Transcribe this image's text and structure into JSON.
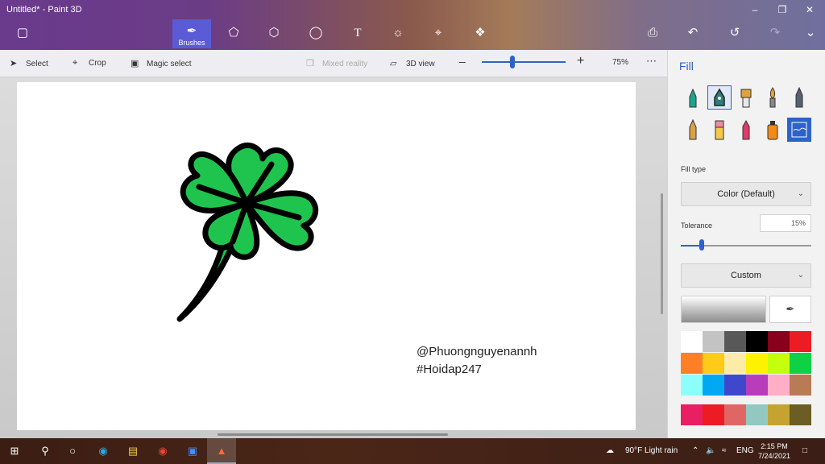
{
  "window": {
    "title": "Untitled* - Paint 3D"
  },
  "toolbar": {
    "tools": [
      {
        "name": "brushes",
        "label": "Brushes",
        "icon": "brush-icon",
        "active": true
      },
      {
        "name": "2d-shapes",
        "label": "",
        "icon": "2d-shapes-icon"
      },
      {
        "name": "3d-shapes",
        "label": "",
        "icon": "3d-shapes-icon"
      },
      {
        "name": "stickers",
        "label": "",
        "icon": "stickers-icon"
      },
      {
        "name": "text",
        "label": "",
        "icon": "text-icon"
      },
      {
        "name": "effects",
        "label": "",
        "icon": "effects-icon"
      },
      {
        "name": "canvas",
        "label": "",
        "icon": "canvas-icon"
      },
      {
        "name": "3d-library",
        "label": "",
        "icon": "3d-library-icon"
      }
    ]
  },
  "subbar": {
    "select": "Select",
    "crop": "Crop",
    "magic_select": "Magic select",
    "mixed_reality": "Mixed reality",
    "view_3d": "3D view",
    "zoom": "75%",
    "zoom_level": 0.38
  },
  "canvas": {
    "watermark_line1": "@Phuongnguyenannh",
    "watermark_line2": "#Hoidap247"
  },
  "panel": {
    "title": "Fill",
    "fill_type_label": "Fill type",
    "fill_type_value": "Color (Default)",
    "tolerance_label": "Tolerance",
    "tolerance_value": "15%",
    "tolerance_level": 0.15,
    "color_mode": "Custom",
    "brushes": [
      {
        "name": "marker",
        "color": "#1aa68c"
      },
      {
        "name": "calligraphy-pen",
        "color": "#2d7d7a"
      },
      {
        "name": "oil-brush",
        "color": "#e0a43c"
      },
      {
        "name": "watercolor",
        "color": "#f0a030"
      },
      {
        "name": "pixel-pen",
        "color": "#556070"
      },
      {
        "name": "pencil",
        "color": "#d9a24a"
      },
      {
        "name": "eraser",
        "color": "#f08aa0"
      },
      {
        "name": "crayon",
        "color": "#e23a6a"
      },
      {
        "name": "spray-can",
        "color": "#f28a1a"
      },
      {
        "name": "fill",
        "color": "#2d62c9"
      }
    ],
    "swatches": [
      "#ffffff",
      "#c3c3c3",
      "#585858",
      "#000000",
      "#88001b",
      "#ec1c24",
      "#ff7f27",
      "#ffca18",
      "#fdeca6",
      "#fff200",
      "#c4ff0e",
      "#0ed145",
      "#8cfffb",
      "#00a8f3",
      "#3f48cc",
      "#b83dba",
      "#ffaec8",
      "#b97a56",
      "#e91e63",
      "#ed1c24",
      "#e06666",
      "#93c8c1",
      "#c4a331",
      "#6b5d23"
    ]
  },
  "taskbar": {
    "weather": "90°F  Light rain",
    "lang": "ENG",
    "time": "2:15 PM",
    "date": "7/24/2021"
  }
}
